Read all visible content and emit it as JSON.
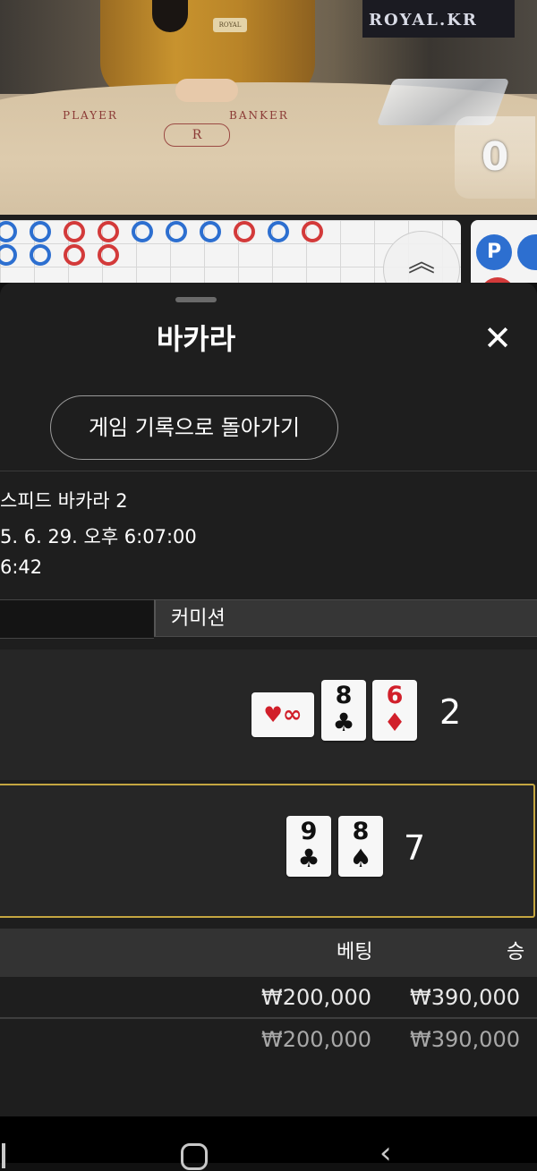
{
  "video": {
    "brand": "ROYAL.KR",
    "badge": "ROYAL",
    "player_label": "PLAYER",
    "banker_label": "BANKER",
    "table_logo": "R",
    "card_counter": "0"
  },
  "roadmap": {
    "beads_row1": [
      "p",
      "p",
      "b",
      "b",
      "p",
      "p",
      "p",
      "b",
      "p",
      "b"
    ],
    "beads_row2": [
      "p",
      "p",
      "b",
      "b"
    ],
    "scroll_icon": "chevron-double-up-icon",
    "mini_letter": "P"
  },
  "sheet": {
    "title": "바카라",
    "close_icon": "close-icon",
    "back_button": "게임 기록으로 돌아가기",
    "game_name": "스피드 바카라 2",
    "datetime": "5. 6. 29. 오후 6:07:00",
    "round_id": "6:42",
    "tab_label": "커미션"
  },
  "hands": {
    "player": {
      "cards": [
        {
          "rank": "∞",
          "suit": "♥",
          "color": "red",
          "sideways": true
        },
        {
          "rank": "8",
          "suit": "♣",
          "color": "black"
        },
        {
          "rank": "6",
          "suit": "♦",
          "color": "red"
        }
      ],
      "total": "2"
    },
    "banker": {
      "cards": [
        {
          "rank": "9",
          "suit": "♣",
          "color": "black"
        },
        {
          "rank": "8",
          "suit": "♠",
          "color": "black"
        }
      ],
      "total": "7"
    }
  },
  "bets_table": {
    "headers": {
      "bet": "베팅",
      "win": "승"
    },
    "rows": [
      {
        "bet": "₩200,000",
        "win": "₩390,000"
      },
      {
        "bet": "₩200,000",
        "win": "₩390,000"
      }
    ]
  },
  "colors": {
    "player_blue": "#2d6fd0",
    "banker_red": "#d33a3a",
    "highlight_gold": "#c4a641",
    "sheet_bg": "#1e1e1e"
  }
}
